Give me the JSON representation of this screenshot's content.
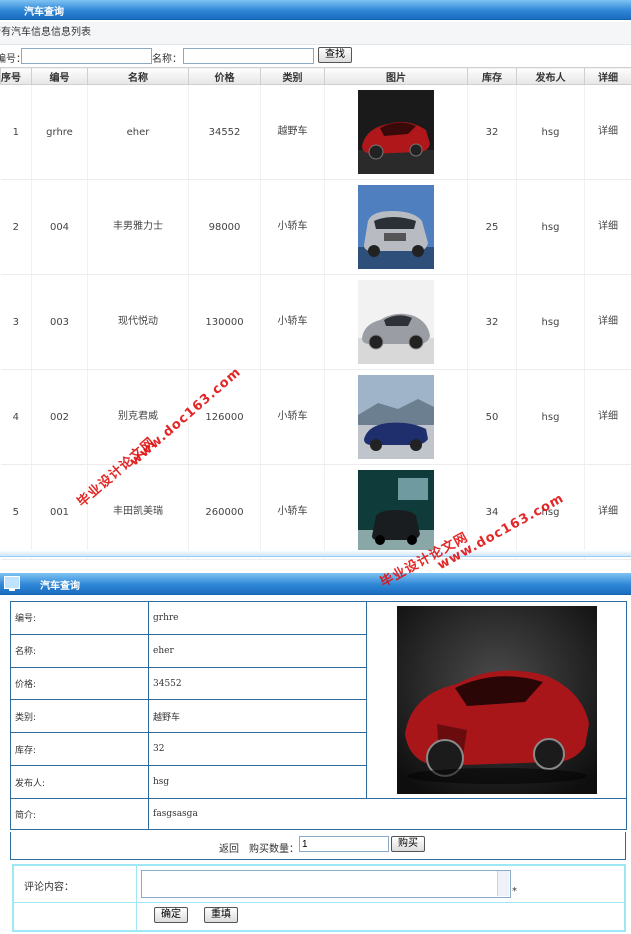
{
  "header": {
    "title": "汽车查询"
  },
  "list_title": "所有汽车信息信息列表",
  "search": {
    "label_id": "编号：",
    "label_name": "名称：",
    "button": "查找"
  },
  "columns": [
    "序号",
    "编号",
    "名称",
    "价格",
    "类别",
    "图片",
    "库存",
    "发布人",
    "详细"
  ],
  "rows": [
    {
      "seq": "1",
      "code": "grhre",
      "name": "eher",
      "price": "34552",
      "category": "越野车",
      "stock": "32",
      "publisher": "hsg",
      "detail": "详细",
      "img": "red-sports-car"
    },
    {
      "seq": "2",
      "code": "004",
      "name": "丰男雅力士",
      "price": "98000",
      "category": "小轿车",
      "stock": "25",
      "publisher": "hsg",
      "detail": "详细",
      "img": "silver-suv"
    },
    {
      "seq": "3",
      "code": "003",
      "name": "现代悦动",
      "price": "130000",
      "category": "小轿车",
      "stock": "32",
      "publisher": "hsg",
      "detail": "详细",
      "img": "silver-coupe"
    },
    {
      "seq": "4",
      "code": "002",
      "name": "别克君威",
      "price": "126000",
      "category": "小轿车",
      "stock": "50",
      "publisher": "hsg",
      "detail": "详细",
      "img": "blue-convertible"
    },
    {
      "seq": "5",
      "code": "001",
      "name": "丰田凯美瑞",
      "price": "260000",
      "category": "小轿车",
      "stock": "34",
      "publisher": "hsg",
      "detail": "详细",
      "img": "dark-suv"
    }
  ],
  "detail_header": {
    "title": "汽车查询"
  },
  "detail": {
    "fields": [
      {
        "label": "编号:",
        "value": "grhre"
      },
      {
        "label": "名称:",
        "value": "eher"
      },
      {
        "label": "价格:",
        "value": "34552"
      },
      {
        "label": "类别:",
        "value": "越野车"
      },
      {
        "label": "库存:",
        "value": "32"
      },
      {
        "label": "发布人:",
        "value": "hsg"
      }
    ],
    "intro_label": "简介:",
    "intro_value": "fasgsasga",
    "image": "red-sports-car"
  },
  "buy": {
    "back": "返回",
    "qty_label": "购买数量：",
    "qty_value": "1",
    "button": "购买"
  },
  "comment": {
    "label": "评论内容：",
    "required_mark": "*",
    "submit": "确定",
    "reset": "重填"
  },
  "watermark": {
    "line1": "www.doc163.com",
    "line2": "毕业设计论文网"
  },
  "colors": {
    "header_blue": "#2f87d6",
    "border_blue": "#2e6c9e",
    "comment_border": "#9ee7f5",
    "watermark_red": "#e01010"
  }
}
